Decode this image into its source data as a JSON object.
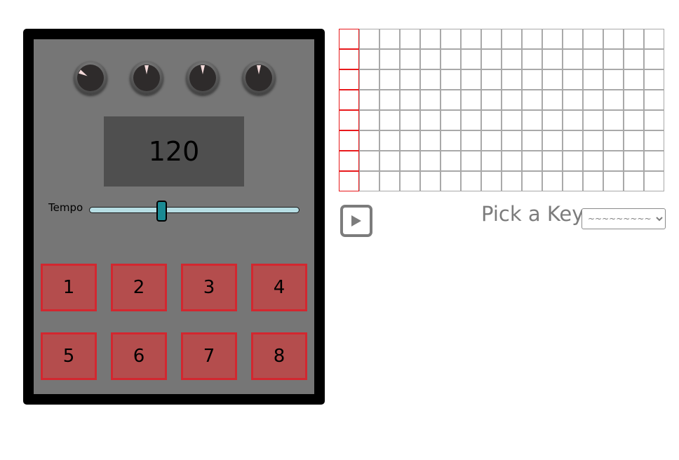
{
  "device": {
    "display_value": "120",
    "tempo_label": "Tempo",
    "tempo_slider_fraction": 0.34,
    "knobs": [
      {
        "name": "knob-1",
        "angle_deg": -60
      },
      {
        "name": "knob-2",
        "angle_deg": 0
      },
      {
        "name": "knob-3",
        "angle_deg": 0
      },
      {
        "name": "knob-4",
        "angle_deg": 0
      }
    ],
    "pads": [
      "1",
      "2",
      "3",
      "4",
      "5",
      "6",
      "7",
      "8"
    ]
  },
  "sequencer": {
    "rows": 8,
    "columns": 16,
    "active_column": 0,
    "active_color": "#e8191c",
    "cell_border_color": "#a9a9a9"
  },
  "controls": {
    "play_icon": "play-icon",
    "key_label": "Pick a Key:",
    "key_select_value": "~~~~~~~~~~"
  },
  "colors": {
    "device_frame": "#000000",
    "panel": "#767676",
    "display_bg": "#4f4f4f",
    "pad_fill": "#b44d4d",
    "pad_border": "#d3272f",
    "slider_thumb": "#1a8a93",
    "slider_track": "#b6dde3"
  }
}
